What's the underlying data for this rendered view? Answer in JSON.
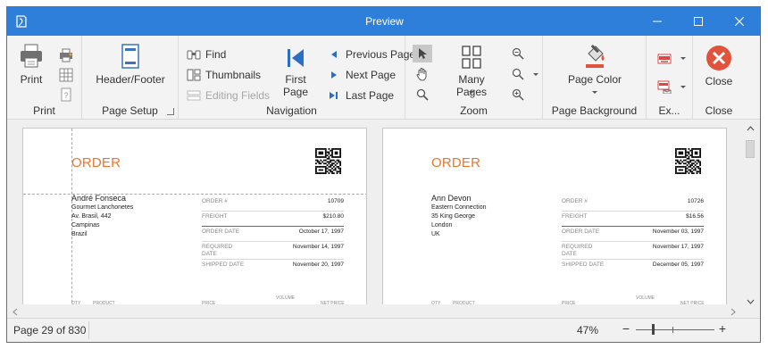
{
  "window": {
    "title": "Preview"
  },
  "ribbon": {
    "print_group": {
      "caption": "Print",
      "print_label": "Print"
    },
    "page_setup_group": {
      "caption": "Page Setup",
      "header_footer_label": "Header/Footer"
    },
    "navigation_group": {
      "caption": "Navigation",
      "find_label": "Find",
      "thumbnails_label": "Thumbnails",
      "editing_fields_label": "Editing Fields",
      "first_page_label_1": "First",
      "first_page_label_2": "Page",
      "previous_page_label": "Previous Page",
      "next_page_label": "Next Page",
      "last_page_label": "Last Page"
    },
    "zoom_group": {
      "caption": "Zoom",
      "many_pages_label": "Many Pages"
    },
    "page_background_group": {
      "caption": "Page Background",
      "page_color_label": "Page Color"
    },
    "export_group": {
      "caption": "Ex..."
    },
    "close_group": {
      "caption": "Close",
      "close_label": "Close"
    }
  },
  "pages": [
    {
      "order_title": "ORDER",
      "customer_name": "André Fonseca",
      "company": "Gourmet Lanchonetes",
      "street": "Av. Brasil, 442",
      "city": "Campinas",
      "country": "Brazil",
      "order_no_label": "ORDER #",
      "order_no": "10709",
      "freight_label": "FREIGHT",
      "freight": "$210.80",
      "order_date_label": "ORDER DATE",
      "order_date": "October 17, 1997",
      "required_date_label_1": "REQUIRED",
      "required_date_label_2": "DATE",
      "required_date": "November 14, 1997",
      "shipped_date_label": "SHIPPED DATE",
      "shipped_date": "November 20, 1997",
      "col_qty": "QTY",
      "col_product": "PRODUCT",
      "col_price": "PRICE",
      "col_volume": "VOLUME",
      "col_net_price": "NET PRICE"
    },
    {
      "order_title": "ORDER",
      "customer_name": "Ann Devon",
      "company": "Eastern Connection",
      "street": "35 King George",
      "city": "London",
      "country": "UK",
      "order_no_label": "ORDER #",
      "order_no": "10726",
      "freight_label": "FREIGHT",
      "freight": "$16.56",
      "order_date_label": "ORDER DATE",
      "order_date": "November 03, 1997",
      "required_date_label_1": "REQUIRED",
      "required_date_label_2": "DATE",
      "required_date": "November 17, 1997",
      "shipped_date_label": "SHIPPED DATE",
      "shipped_date": "December 05, 1997",
      "col_qty": "QTY",
      "col_product": "PRODUCT",
      "col_price": "PRICE",
      "col_volume": "VOLUME",
      "col_net_price": "NET PRICE"
    }
  ],
  "status": {
    "page_info": "Page 29 of 830",
    "zoom_level": "47%",
    "zoom_minus": "−",
    "zoom_plus": "+",
    "zoom_fraction": 0.47
  },
  "colors": {
    "titlebar": "#2e7fd9",
    "accent_orange": "#e8762d",
    "close_red": "#e2533b",
    "nav_blue": "#2a6fc4"
  }
}
